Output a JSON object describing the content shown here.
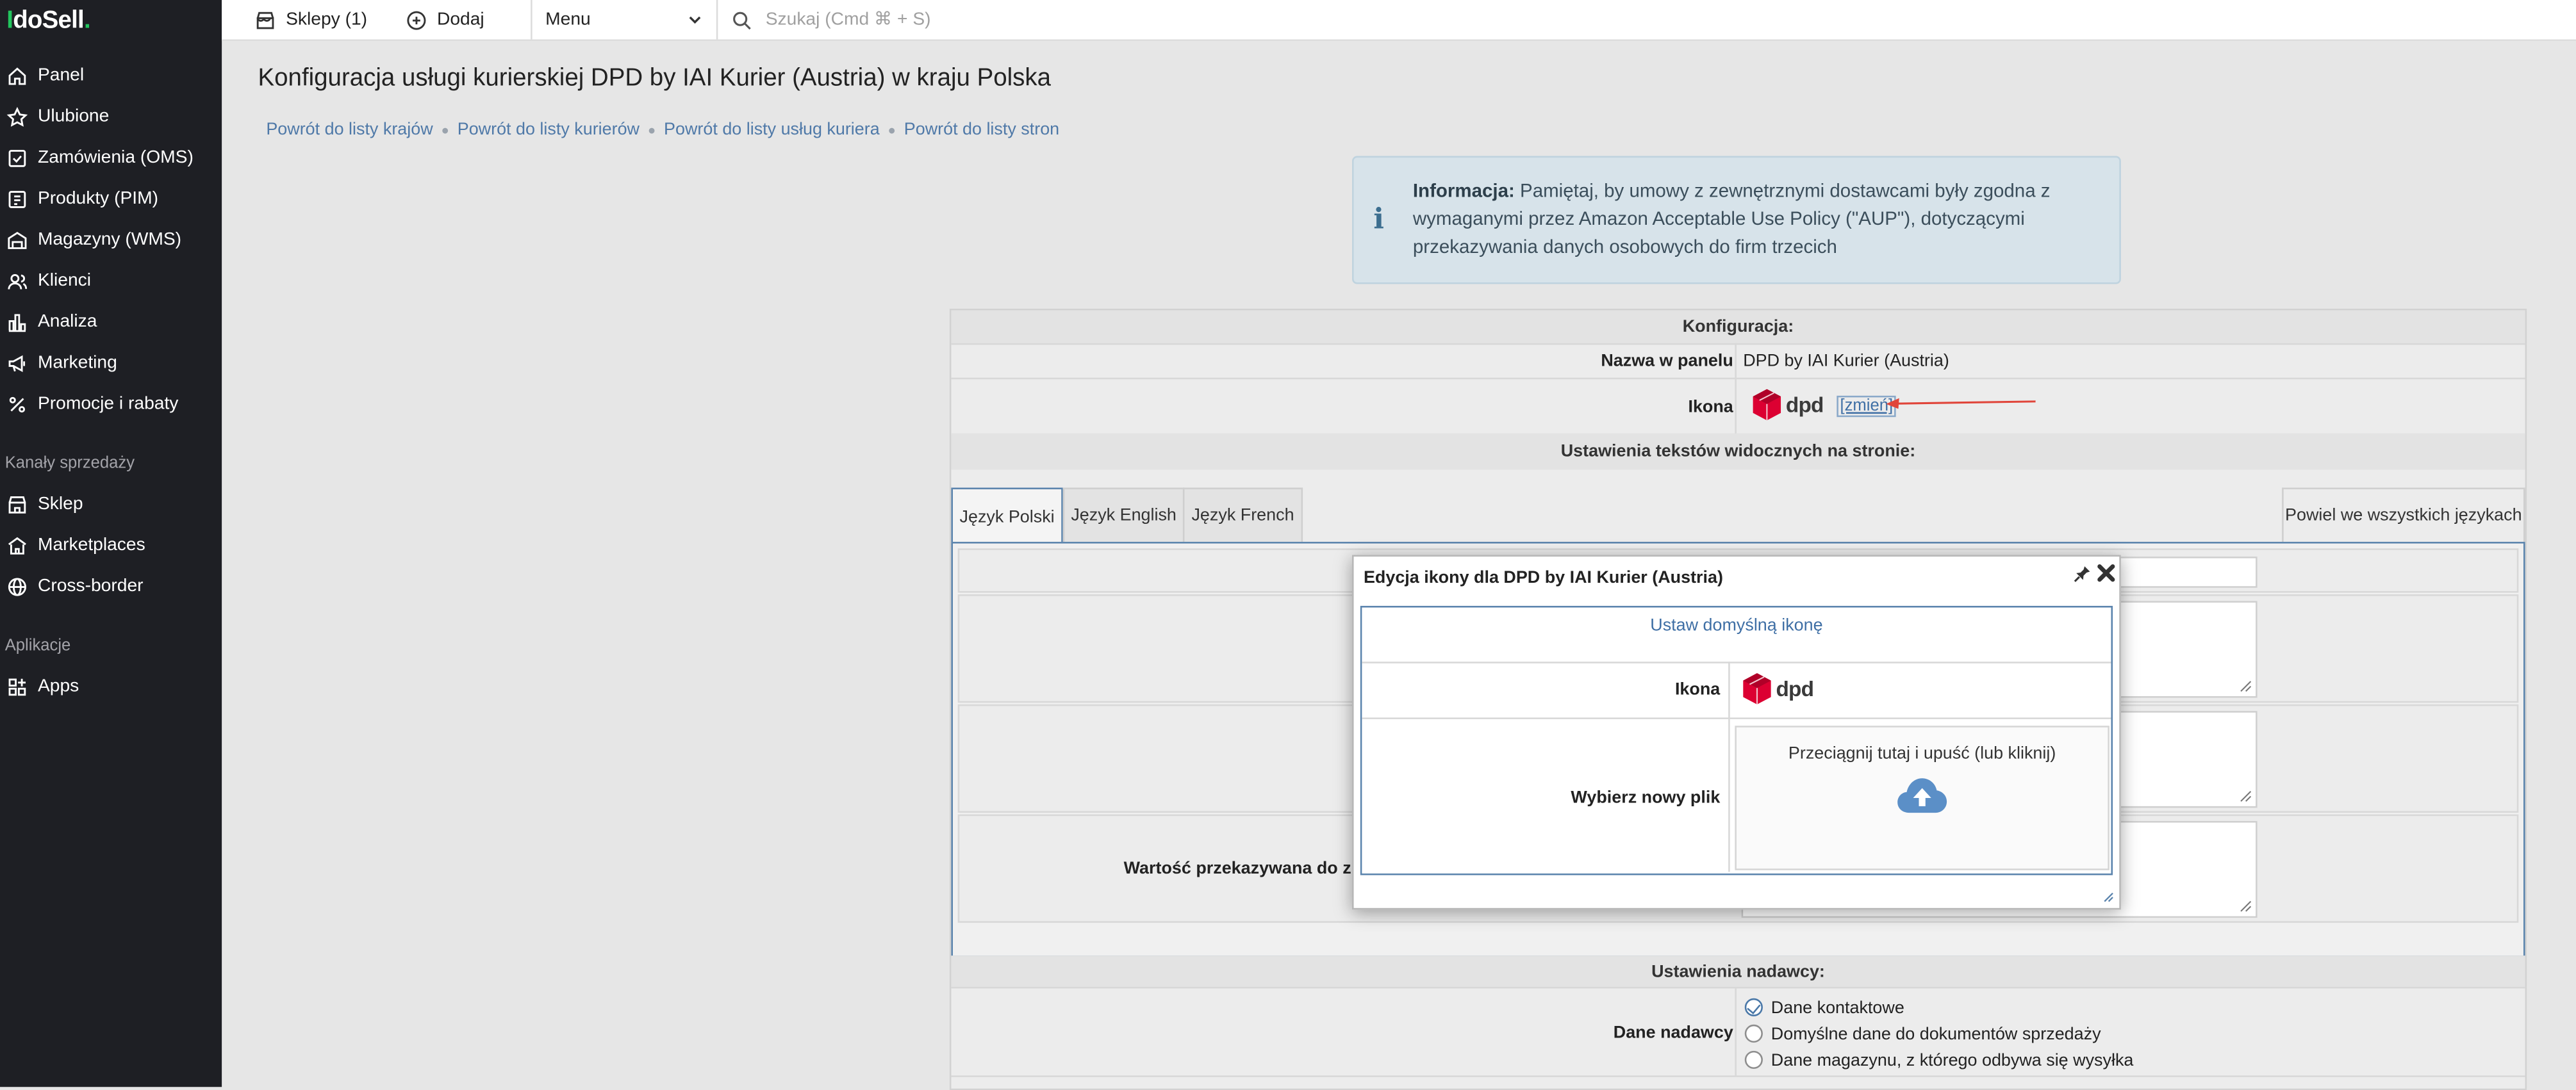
{
  "brand": {
    "part1": "I",
    "part2": "doSell",
    "part3": "."
  },
  "sidebar": {
    "items": [
      {
        "label": "Panel",
        "icon": "home-icon"
      },
      {
        "label": "Ulubione",
        "icon": "star-icon"
      },
      {
        "label": "Zamówienia (OMS)",
        "icon": "orders-icon"
      },
      {
        "label": "Produkty (PIM)",
        "icon": "products-icon"
      },
      {
        "label": "Magazyny (WMS)",
        "icon": "warehouse-icon"
      },
      {
        "label": "Klienci",
        "icon": "users-icon"
      },
      {
        "label": "Analiza",
        "icon": "analytics-icon"
      },
      {
        "label": "Marketing",
        "icon": "megaphone-icon"
      },
      {
        "label": "Promocje i rabaty",
        "icon": "percent-icon"
      }
    ],
    "section_sales": "Kanały sprzedaży",
    "sales_items": [
      {
        "label": "Sklep",
        "icon": "shop-icon"
      },
      {
        "label": "Marketplaces",
        "icon": "marketplaces-icon"
      },
      {
        "label": "Cross-border",
        "icon": "globe-icon"
      }
    ],
    "section_apps": "Aplikacje",
    "apps_items": [
      {
        "label": "Apps",
        "icon": "apps-icon"
      }
    ]
  },
  "topbar": {
    "shops_label": "Sklepy (1)",
    "add_label": "Dodaj",
    "menu_label": "Menu",
    "search_placeholder": "Szukaj (Cmd ⌘ + S)"
  },
  "page": {
    "title": "Konfiguracja usługi kurierskiej DPD by IAI Kurier (Austria) w kraju Polska",
    "breadcrumbs": [
      "Powrót do listy krajów",
      "Powrót do listy kurierów",
      "Powrót do listy usług kuriera",
      "Powrót do listy stron"
    ]
  },
  "info": {
    "title": "Informacja:",
    "text": "Pamiętaj, by umowy z zewnętrznymi dostawcami były zgodna z wymaganymi przez Amazon Acceptable Use Policy (\"AUP\"), dotyczącymi przekazywania danych osobowych do firm trzecich"
  },
  "config": {
    "header": "Konfiguracja:",
    "name_label": "Nazwa w panelu",
    "name_value": "DPD by IAI Kurier (Austria)",
    "icon_label": "Ikona",
    "logo_word": "dpd",
    "change_link": "[zmień]",
    "texts_header": "Ustawienia tekstów widocznych na stronie:",
    "tabs": [
      "Język Polski",
      "Język English",
      "Język French"
    ],
    "repeat_all": "Powiel we wszystkich językach",
    "field_value_label": "Wartość przekazywana do zmie",
    "sender_header": "Ustawienia nadawcy:",
    "sender_label": "Dane nadawcy",
    "sender_options": [
      "Dane kontaktowe",
      "Domyślne dane do dokumentów sprzedaży",
      "Dane magazynu, z którego odbywa się wysyłka"
    ],
    "sender_selected": 0
  },
  "dialog": {
    "title": "Edycja ikony dla DPD by IAI Kurier (Austria)",
    "default_icon_link": "Ustaw domyślną ikonę",
    "icon_label": "Ikona",
    "logo_word": "dpd",
    "file_label": "Wybierz nowy plik",
    "drop_text": "Przeciągnij tutaj i upuść (lub kliknij)"
  },
  "colors": {
    "sidebar_bg": "#1e1f24",
    "brand_green": "#22c55e",
    "link_blue": "#4f79a8",
    "dpd_red": "#dc0032",
    "upload_blue": "#5b8fc7",
    "annotation_red": "#e0453a"
  }
}
